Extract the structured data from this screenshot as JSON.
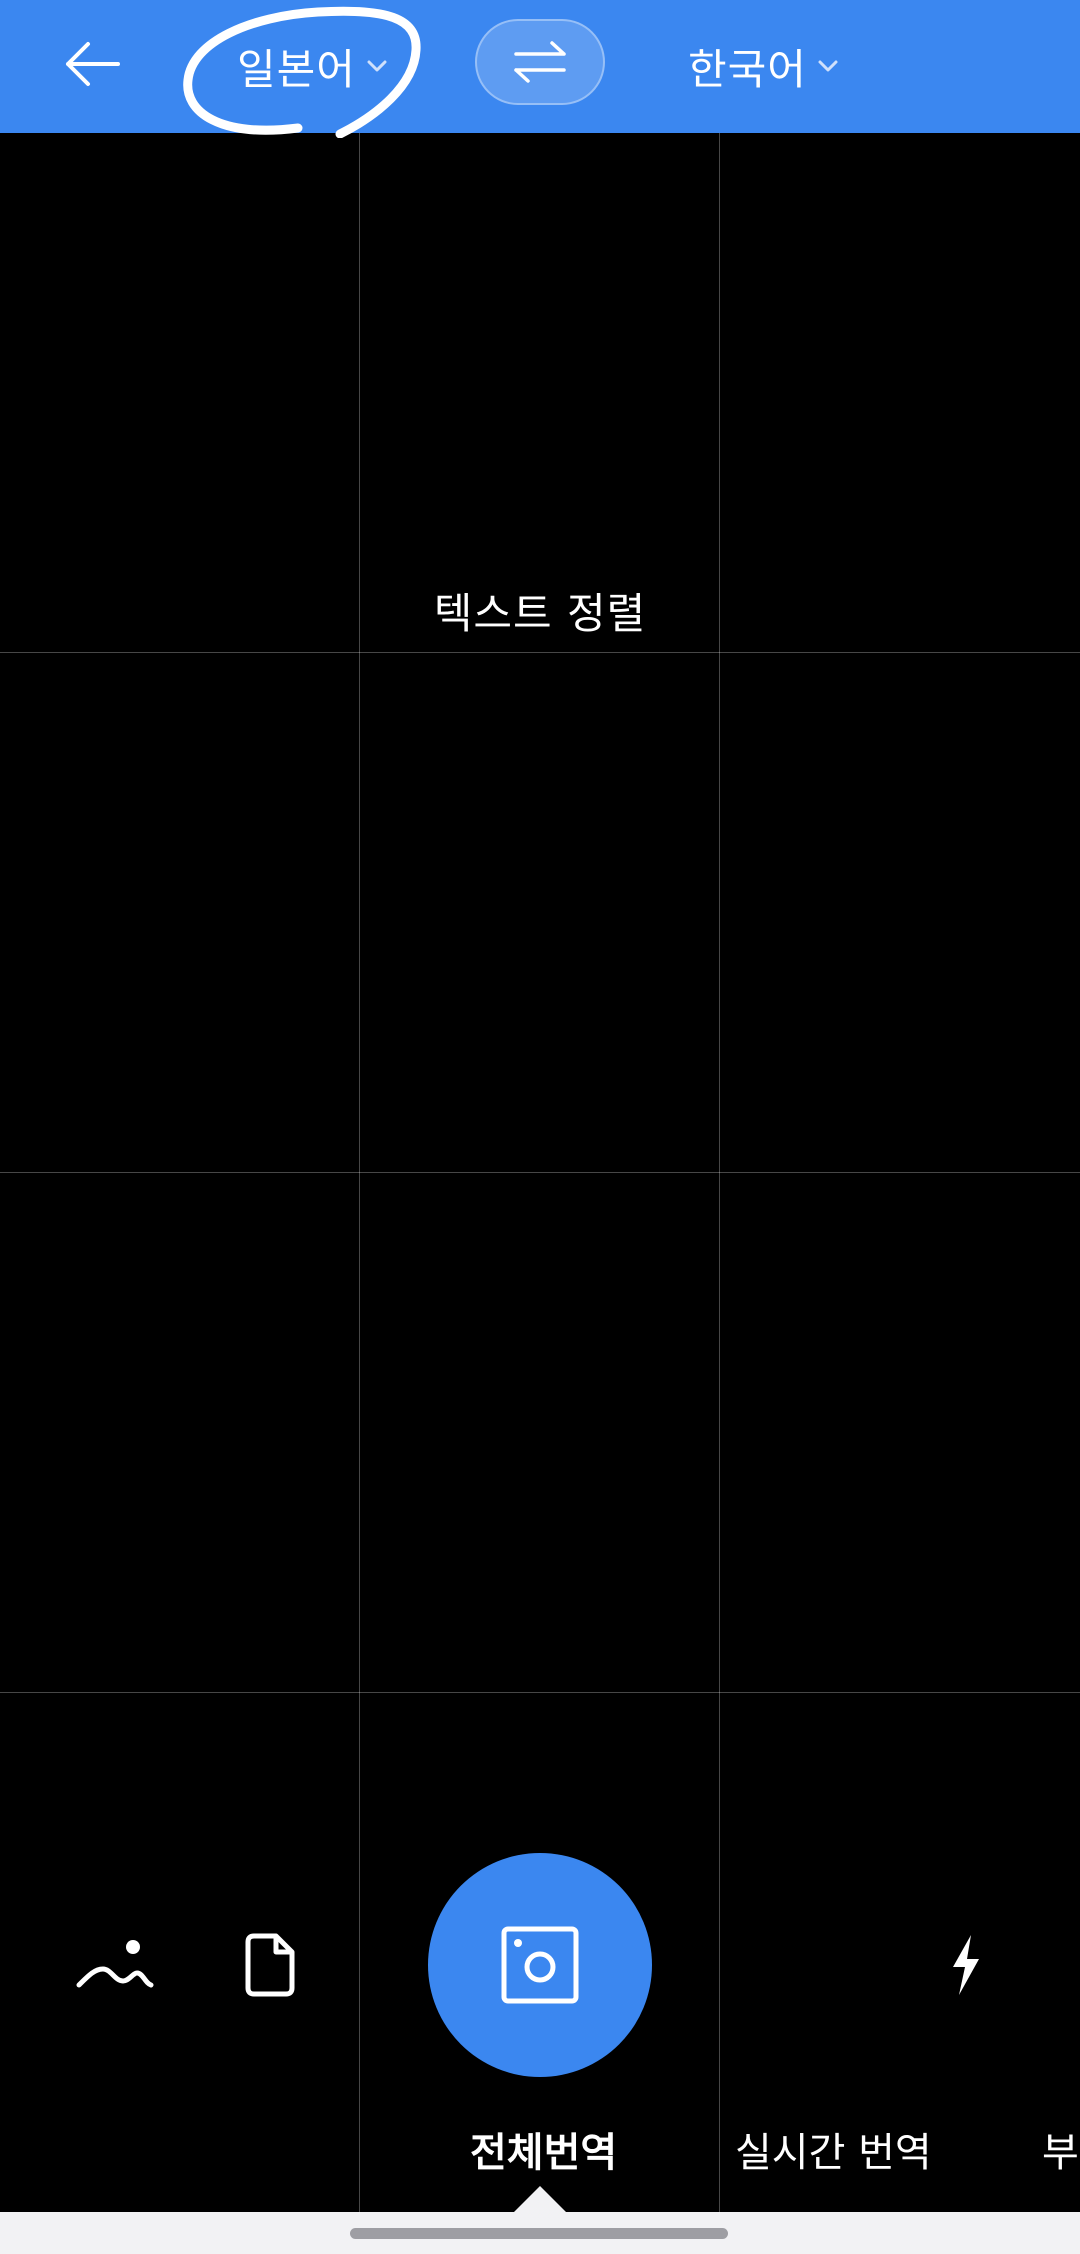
{
  "header": {
    "source_language": "일본어",
    "target_language": "한국어",
    "back_icon": "arrow-left-icon",
    "swap_icon": "swap-arrows-icon",
    "dropdown_icon": "chevron-down-icon",
    "background_color": "#3b87f0"
  },
  "camera": {
    "alignment_hint": "텍스트 정렬"
  },
  "toolbar": {
    "gallery_icon": "image-gallery-icon",
    "file_icon": "document-file-icon",
    "shutter_icon": "camera-shutter-icon",
    "flash_icon": "flash-icon",
    "accent_color": "#3b87f0"
  },
  "modes": {
    "tabs": [
      {
        "label": "전체번역",
        "active": true
      },
      {
        "label": "실시간 번역",
        "active": false
      },
      {
        "label": "부",
        "active": false
      }
    ]
  }
}
